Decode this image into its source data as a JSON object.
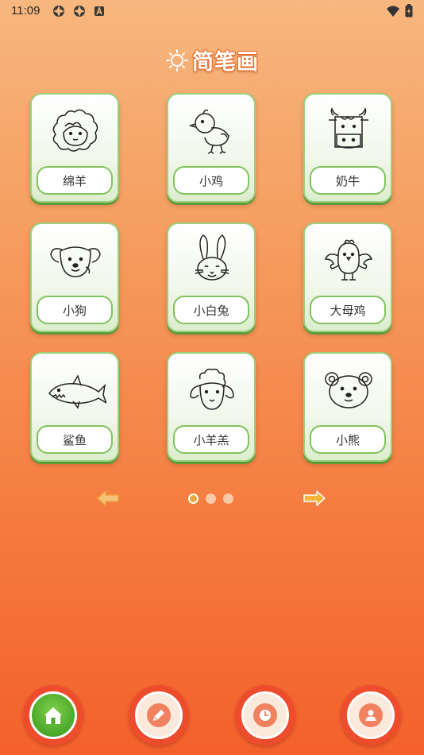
{
  "status_bar": {
    "time": "11:09",
    "left_icons": [
      "notification-app-icon",
      "notification-app-icon",
      "app-a-icon"
    ],
    "right_icons": [
      "wifi-icon",
      "battery-icon"
    ]
  },
  "header": {
    "title": "简笔画",
    "icon": "sun-icon"
  },
  "drawings": [
    {
      "label": "绵羊",
      "icon": "sheep-drawing"
    },
    {
      "label": "小鸡",
      "icon": "chick-drawing"
    },
    {
      "label": "奶牛",
      "icon": "cow-drawing"
    },
    {
      "label": "小狗",
      "icon": "puppy-drawing"
    },
    {
      "label": "小白兔",
      "icon": "rabbit-drawing"
    },
    {
      "label": "大母鸡",
      "icon": "hen-drawing"
    },
    {
      "label": "鲨鱼",
      "icon": "shark-drawing"
    },
    {
      "label": "小羊羔",
      "icon": "lamb-drawing"
    },
    {
      "label": "小熊",
      "icon": "bear-drawing"
    }
  ],
  "pager": {
    "current_page": 1,
    "total_pages": 3,
    "prev_icon": "arrow-left-icon",
    "next_icon": "arrow-right-icon"
  },
  "bottom_nav": [
    {
      "name": "home",
      "icon": "home-icon",
      "active": true
    },
    {
      "name": "draw",
      "icon": "pen-icon",
      "active": false
    },
    {
      "name": "history",
      "icon": "clock-icon",
      "active": false
    },
    {
      "name": "profile",
      "icon": "user-icon",
      "active": false
    }
  ],
  "colors": {
    "accent_green": "#4aa72a",
    "nav_red": "#ee4d2d",
    "arrow_orange": "#f0a23c"
  }
}
